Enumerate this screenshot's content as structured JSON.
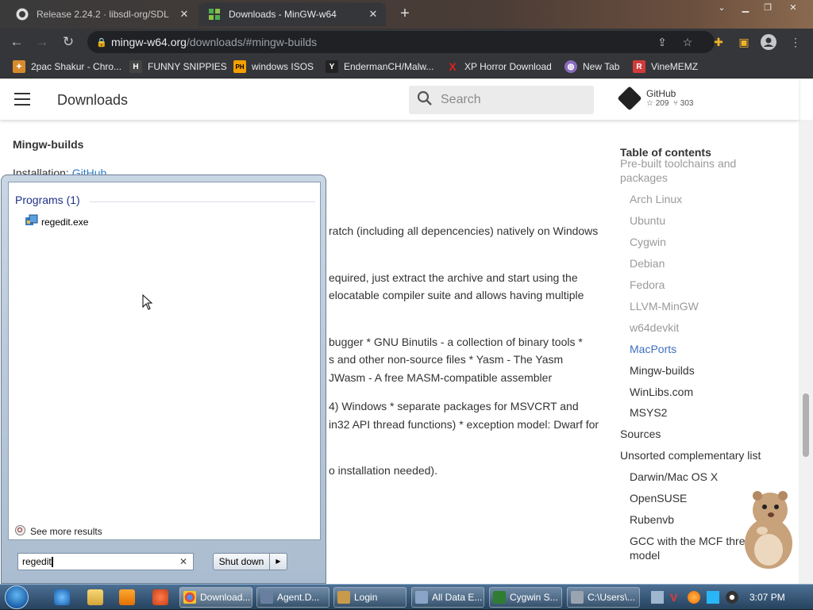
{
  "browser": {
    "tabs": [
      {
        "title": "Release 2.24.2 · libsdl-org/SDL",
        "icon": "github-icon",
        "active": false
      },
      {
        "title": "Downloads - MinGW-w64",
        "icon": "mingw-icon",
        "active": true
      }
    ],
    "url_host": "mingw-w64.org",
    "url_path": "/downloads/#mingw-builds",
    "bookmarks": [
      {
        "label": "2pac Shakur - Chro...",
        "icon": "puzzle-icon",
        "color": "#d88b2c"
      },
      {
        "label": "FUNNY SNIPPIES",
        "icon": "h-icon",
        "color": "#444444",
        "glyph": "H"
      },
      {
        "label": "windows ISOS",
        "icon": "ph-icon",
        "color": "#f5a000",
        "glyph": "PH"
      },
      {
        "label": "EndermanCH/Malw...",
        "icon": "yp-icon",
        "color": "#222222",
        "glyph": "Y"
      },
      {
        "label": "XP Horror Download",
        "icon": "x-icon",
        "color": "#e02020",
        "glyph": "X"
      },
      {
        "label": "New Tab",
        "icon": "globe-icon",
        "color": "#8a6bbf"
      },
      {
        "label": "VineMEMZ",
        "icon": "vine-icon",
        "color": "#d33a3a",
        "glyph": "R"
      }
    ]
  },
  "site": {
    "title": "Downloads",
    "search_placeholder": "Search",
    "github_label": "GitHub",
    "github_stars": "209",
    "github_forks": "303"
  },
  "content": {
    "section_heading": "Mingw-builds",
    "installation_label": "Installation:",
    "installation_link": "GitHub",
    "lines": [
      "ratch (including all depencencies) natively on Windows",
      "equired, just extract the archive and start using the",
      "elocatable compiler suite and allows having multiple",
      "bugger * GNU Binutils - a collection of binary tools *",
      "s and other non-source files * Yasm - The Yasm",
      "JWasm - A free MASM-compatible assembler",
      "4) Windows * separate packages for MSVCRT and",
      "in32 API thread functions) * exception model: Dwarf for",
      "o installation needed)."
    ]
  },
  "toc": {
    "heading": "Table of contents",
    "items": [
      {
        "label": "Pre-built toolchains and",
        "level": 0,
        "state": "muted"
      },
      {
        "label": "packages",
        "level": 0,
        "state": "muted"
      },
      {
        "label": "Arch Linux",
        "level": 1,
        "state": "muted"
      },
      {
        "label": "Ubuntu",
        "level": 1,
        "state": "muted"
      },
      {
        "label": "Cygwin",
        "level": 1,
        "state": "muted"
      },
      {
        "label": "Debian",
        "level": 1,
        "state": "muted"
      },
      {
        "label": "Fedora",
        "level": 1,
        "state": "muted"
      },
      {
        "label": "LLVM-MinGW",
        "level": 1,
        "state": "muted"
      },
      {
        "label": "w64devkit",
        "level": 1,
        "state": "muted"
      },
      {
        "label": "MacPorts",
        "level": 1,
        "state": "active"
      },
      {
        "label": "Mingw-builds",
        "level": 1,
        "state": "normal"
      },
      {
        "label": "WinLibs.com",
        "level": 1,
        "state": "normal"
      },
      {
        "label": "MSYS2",
        "level": 1,
        "state": "normal"
      },
      {
        "label": "Sources",
        "level": 0,
        "state": "normal"
      },
      {
        "label": "Unsorted complementary list",
        "level": 0,
        "state": "normal"
      },
      {
        "label": "Darwin/Mac OS X",
        "level": 1,
        "state": "normal"
      },
      {
        "label": "OpenSUSE",
        "level": 1,
        "state": "normal"
      },
      {
        "label": "Rubenvb",
        "level": 1,
        "state": "normal"
      },
      {
        "label": "GCC with the MCF thread",
        "level": 1,
        "state": "normal"
      },
      {
        "label": "model",
        "level": 1,
        "state": "normal"
      }
    ]
  },
  "startmenu": {
    "programs_heading": "Programs (1)",
    "result": "regedit.exe",
    "see_more": "See more results",
    "search_value": "regedit",
    "shutdown_label": "Shut down"
  },
  "taskbar": {
    "tasks": [
      {
        "label": "Download...",
        "icon": "chrome-icon",
        "color": "#e24b3b"
      },
      {
        "label": "Agent.D...",
        "icon": "app-icon",
        "color": "#6a7fa0"
      },
      {
        "label": "Login",
        "icon": "agent-icon",
        "color": "#c99a4a"
      },
      {
        "label": "All Data E...",
        "icon": "window-icon",
        "color": "#8aa4c8"
      },
      {
        "label": "Cygwin S...",
        "icon": "cygwin-icon",
        "color": "#2e7d32"
      },
      {
        "label": "C:\\Users\\...",
        "icon": "folder-icon",
        "color": "#9aa4b0"
      }
    ],
    "clock": "3:07 PM"
  },
  "colors": {
    "link": "#2e7cc5",
    "toc_muted": "#9a9a9a",
    "toc_active": "#3f6fc1",
    "toc_normal": "#333333"
  }
}
